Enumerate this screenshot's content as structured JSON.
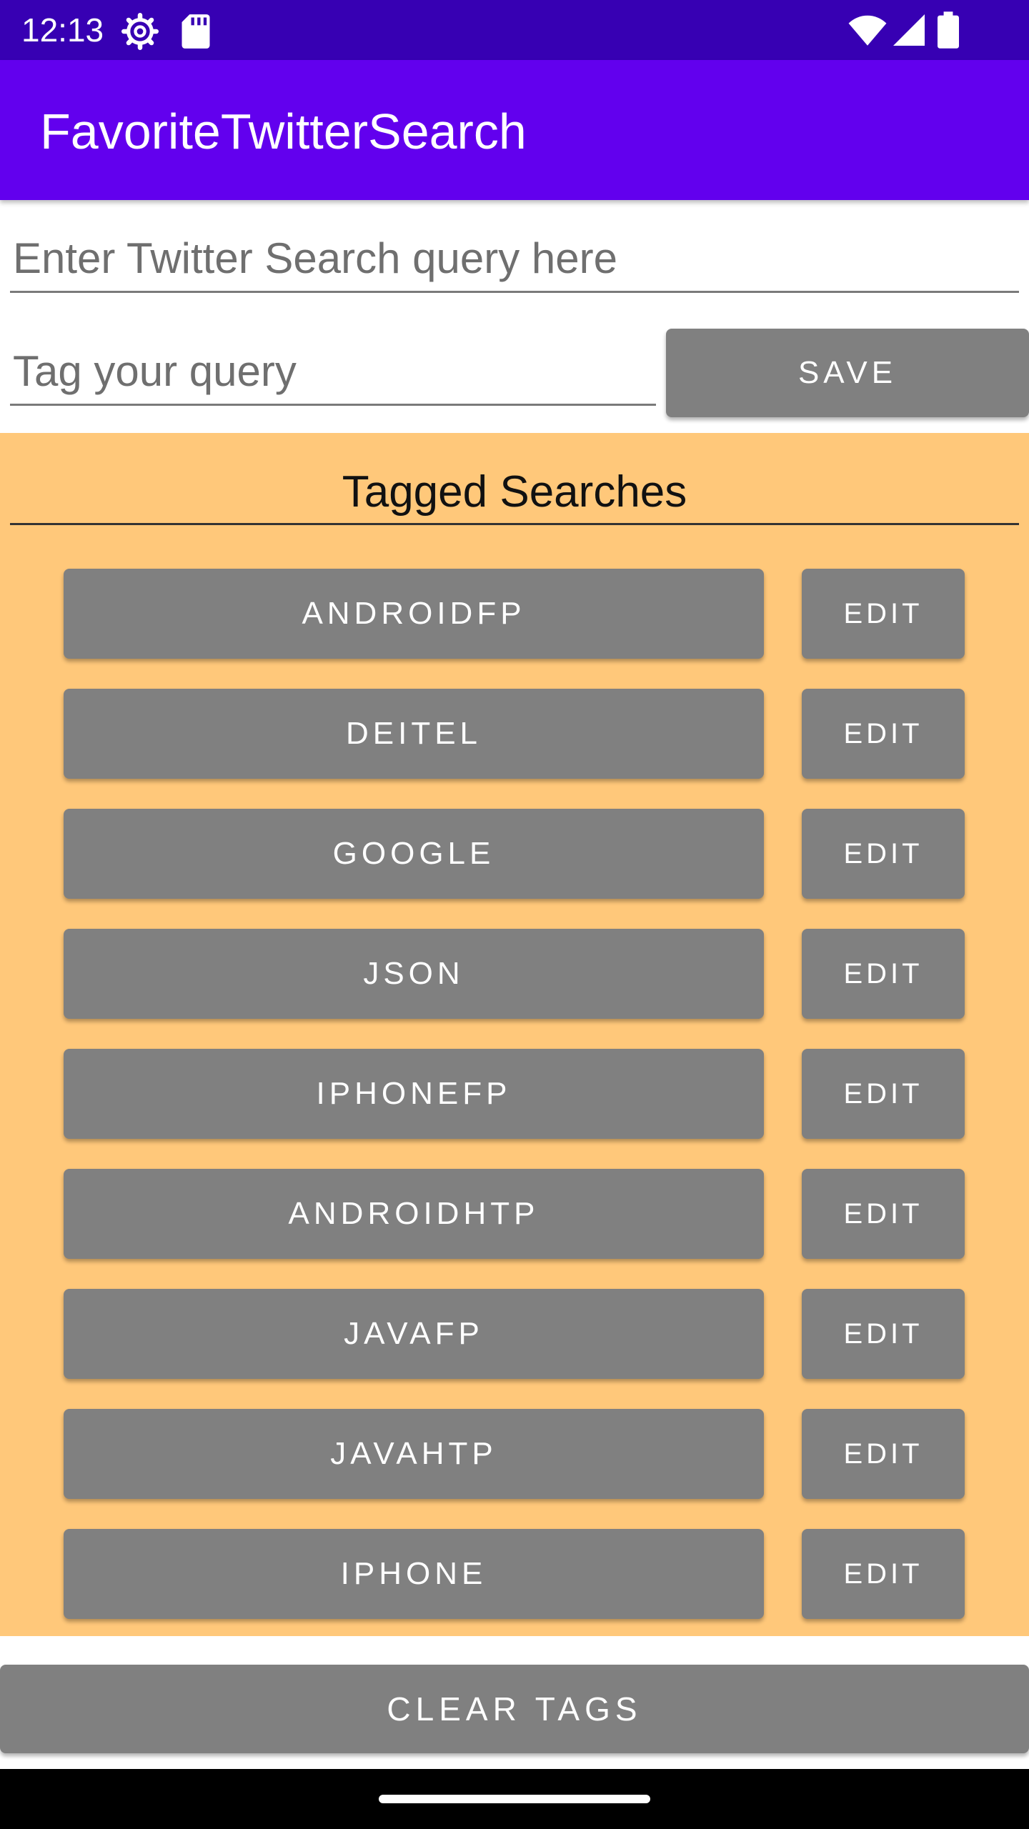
{
  "status_bar": {
    "time": "12:13",
    "icons": [
      "settings-gear-icon",
      "sd-card-icon",
      "wifi-icon",
      "cell-signal-icon",
      "battery-icon"
    ]
  },
  "app_bar": {
    "title": "FavoriteTwitterSearch",
    "color": "#6200ee"
  },
  "query_input": {
    "value": "",
    "placeholder": "Enter Twitter Search query here"
  },
  "tag_input": {
    "value": "",
    "placeholder": "Tag your query"
  },
  "save_button": {
    "label": "SAVE"
  },
  "tagged_searches": {
    "title": "Tagged Searches",
    "background": "#ffc87a",
    "rows": [
      {
        "tag": "ANDROIDFP",
        "edit": "EDIT"
      },
      {
        "tag": "DEITEL",
        "edit": "EDIT"
      },
      {
        "tag": "GOOGLE",
        "edit": "EDIT"
      },
      {
        "tag": "JSON",
        "edit": "EDIT"
      },
      {
        "tag": "IPHONEFP",
        "edit": "EDIT"
      },
      {
        "tag": "ANDROIDHTP",
        "edit": "EDIT"
      },
      {
        "tag": "JAVAFP",
        "edit": "EDIT"
      },
      {
        "tag": "JAVAHTP",
        "edit": "EDIT"
      },
      {
        "tag": "IPHONE",
        "edit": "EDIT"
      }
    ]
  },
  "clear_button": {
    "label": "CLEAR TAGS"
  },
  "button_color": "#808080"
}
